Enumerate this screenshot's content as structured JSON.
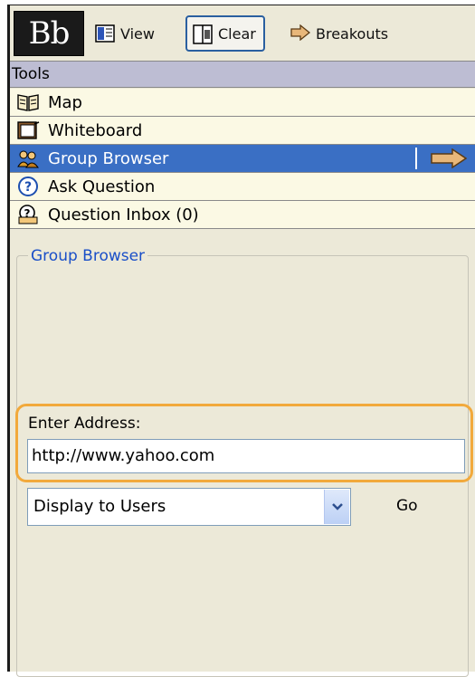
{
  "toolbar": {
    "logo_text": "Bb",
    "view_label": "View",
    "clear_label": "Clear",
    "breakouts_label": "Breakouts"
  },
  "tools": {
    "header": "Tools",
    "items": [
      {
        "label": "Map",
        "icon": "map-book-icon"
      },
      {
        "label": "Whiteboard",
        "icon": "whiteboard-icon"
      },
      {
        "label": "Group Browser",
        "icon": "group-browser-icon",
        "selected": true
      },
      {
        "label": "Ask Question",
        "icon": "question-icon"
      },
      {
        "label": "Question Inbox (0)",
        "icon": "question-inbox-icon"
      }
    ]
  },
  "panel": {
    "legend": "Group Browser",
    "address_label": "Enter Address:",
    "address_value": "http://www.yahoo.com",
    "display_select_value": "Display to Users",
    "go_label": "Go"
  },
  "colors": {
    "selected_row": "#3A6FC4",
    "highlight_outline": "#F2A93B",
    "legend_text": "#1a4fc8",
    "panel_bg": "#ECE9D8"
  }
}
